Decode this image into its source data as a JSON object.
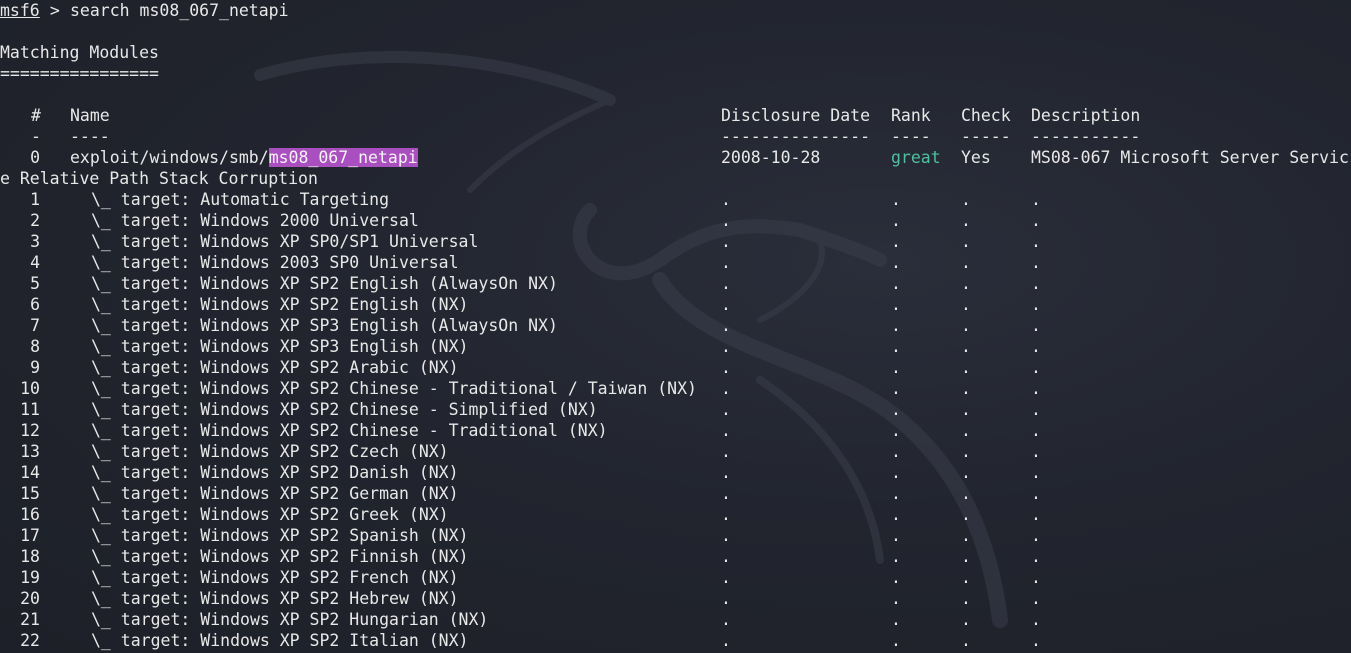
{
  "prompt": {
    "name": "msf6",
    "separator": " > ",
    "command": "search ms08_067_netapi"
  },
  "heading": {
    "title": "Matching Modules",
    "underline": "================"
  },
  "table": {
    "headers": {
      "num": "#",
      "name": "Name",
      "date": "Disclosure Date",
      "rank": "Rank",
      "check": "Check",
      "description": "Description"
    },
    "dividers": {
      "num": "-",
      "name": "----",
      "date": "---------------",
      "rank": "----",
      "check": "-----",
      "description": "-----------"
    },
    "main_row": {
      "num": "0",
      "name_prefix": "exploit/windows/smb/",
      "name_match": "ms08_067_netapi",
      "date": "2008-10-28",
      "rank": "great",
      "check": "Yes",
      "description_first": "MS08-067 Microsoft Server Servic",
      "description_wrap": "e Relative Path Stack Corruption"
    },
    "targets": [
      {
        "num": "1",
        "name": "\\_ target: Automatic Targeting"
      },
      {
        "num": "2",
        "name": "\\_ target: Windows 2000 Universal"
      },
      {
        "num": "3",
        "name": "\\_ target: Windows XP SP0/SP1 Universal"
      },
      {
        "num": "4",
        "name": "\\_ target: Windows 2003 SP0 Universal"
      },
      {
        "num": "5",
        "name": "\\_ target: Windows XP SP2 English (AlwaysOn NX)"
      },
      {
        "num": "6",
        "name": "\\_ target: Windows XP SP2 English (NX)"
      },
      {
        "num": "7",
        "name": "\\_ target: Windows XP SP3 English (AlwaysOn NX)"
      },
      {
        "num": "8",
        "name": "\\_ target: Windows XP SP3 English (NX)"
      },
      {
        "num": "9",
        "name": "\\_ target: Windows XP SP2 Arabic (NX)"
      },
      {
        "num": "10",
        "name": "\\_ target: Windows XP SP2 Chinese - Traditional / Taiwan (NX)"
      },
      {
        "num": "11",
        "name": "\\_ target: Windows XP SP2 Chinese - Simplified (NX)"
      },
      {
        "num": "12",
        "name": "\\_ target: Windows XP SP2 Chinese - Traditional (NX)"
      },
      {
        "num": "13",
        "name": "\\_ target: Windows XP SP2 Czech (NX)"
      },
      {
        "num": "14",
        "name": "\\_ target: Windows XP SP2 Danish (NX)"
      },
      {
        "num": "15",
        "name": "\\_ target: Windows XP SP2 German (NX)"
      },
      {
        "num": "16",
        "name": "\\_ target: Windows XP SP2 Greek (NX)"
      },
      {
        "num": "17",
        "name": "\\_ target: Windows XP SP2 Spanish (NX)"
      },
      {
        "num": "18",
        "name": "\\_ target: Windows XP SP2 Finnish (NX)"
      },
      {
        "num": "19",
        "name": "\\_ target: Windows XP SP2 French (NX)"
      },
      {
        "num": "20",
        "name": "\\_ target: Windows XP SP2 Hebrew (NX)"
      },
      {
        "num": "21",
        "name": "\\_ target: Windows XP SP2 Hungarian (NX)"
      },
      {
        "num": "22",
        "name": "\\_ target: Windows XP SP2 Italian (NX)"
      }
    ],
    "placeholder": "."
  },
  "colors": {
    "background": "#20232c",
    "text": "#e8e8e8",
    "highlight": "#a94fbf",
    "rank_great": "#4fbf9f"
  },
  "icons": {
    "background_watermark": "kali-dragon-icon"
  }
}
